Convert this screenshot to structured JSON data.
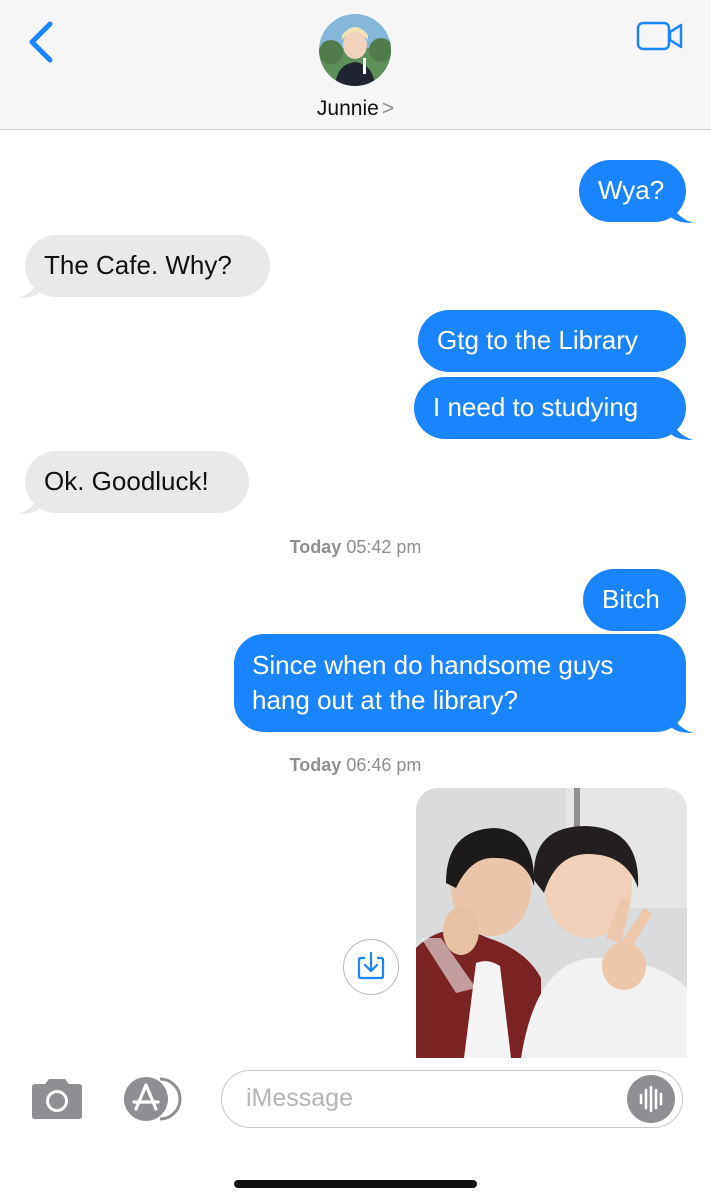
{
  "header": {
    "contact_name": "Junnie",
    "contact_chevron": ">"
  },
  "messages": [
    {
      "from": "me",
      "text": "Wya?"
    },
    {
      "from": "them",
      "text": "The Cafe. Why?"
    },
    {
      "from": "me",
      "text": "Gtg to the Library"
    },
    {
      "from": "me",
      "text": "I need to studying"
    },
    {
      "from": "them",
      "text": "Ok. Goodluck!"
    },
    {
      "from": "me",
      "text": "Bitch"
    },
    {
      "from": "me",
      "text_line1": "Since when do handsome guys",
      "text_line2": "hang out at the library?"
    }
  ],
  "timestamps": [
    {
      "day": "Today",
      "time": "05:42 pm"
    },
    {
      "day": "Today",
      "time": "06:46 pm"
    }
  ],
  "composer": {
    "placeholder": "iMessage"
  },
  "colors": {
    "outgoing": "#1a84ff",
    "incoming": "#e9e9eb",
    "accent": "#1a84ff"
  },
  "icons": [
    "back-chevron-icon",
    "video-camera-icon",
    "download-icon",
    "camera-icon",
    "app-store-icon",
    "audio-waveform-icon"
  ]
}
